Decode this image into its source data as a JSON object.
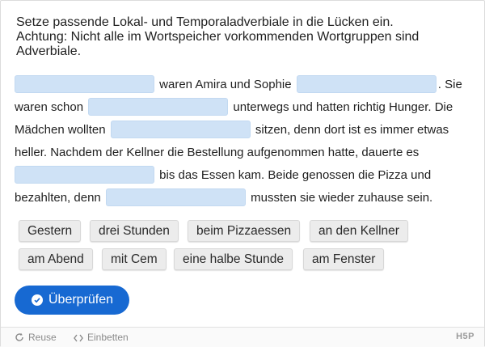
{
  "instructions": {
    "line1": "Setze passende Lokal- und Temporaladverbiale  in die Lücken ein.",
    "line2": "Achtung: Nicht alle im Wortspeicher vorkommenden Wortgruppen sind",
    "line3": "Adverbiale."
  },
  "exercise": {
    "t1": " waren Amira und Sophie ",
    "t2": ". Sie waren schon ",
    "t3": " unterwegs und hatten richtig Hunger. Die Mädchen wollten ",
    "t4": " sitzen, denn dort ist es immer etwas heller. Nachdem der Kellner die Bestellung aufgenommen hatte, dauerte es ",
    "t5": " bis das Essen kam. Beide genossen die Pizza und bezahlten, denn ",
    "t6": " mussten sie wieder zuhause sein."
  },
  "wordbank": [
    "Gestern",
    "drei Stunden",
    "beim Pizzaessen",
    "an den Kellner",
    "am Abend",
    "mit Cem",
    "eine halbe Stunde",
    "am Fenster"
  ],
  "check_button": {
    "label": "Überprüfen",
    "icon": "check-circle-icon"
  },
  "footer": {
    "reuse_label": "Reuse",
    "embed_label": "Einbetten",
    "logo_text": "H5P"
  },
  "colors": {
    "accent": "#1769d2",
    "blank_fill": "#cfe2f6",
    "word_fill": "#ececec"
  }
}
